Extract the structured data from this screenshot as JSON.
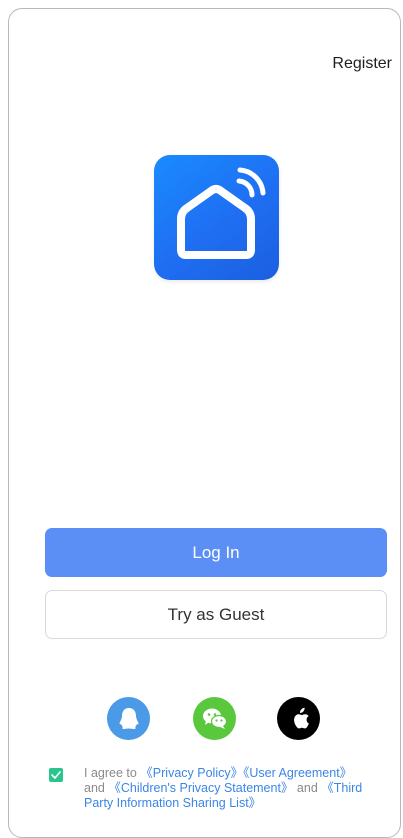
{
  "header": {
    "register_label": "Register"
  },
  "logo": {
    "icon": "smart-home-icon",
    "gradient_from": "#1a8bff",
    "gradient_to": "#1b5fe0"
  },
  "buttons": {
    "login_label": "Log In",
    "guest_label": "Try as Guest",
    "login_color": "#5b8ff6"
  },
  "social": [
    {
      "name": "qq",
      "icon": "qq-penguin-icon",
      "color": "#4a9ae8"
    },
    {
      "name": "wechat",
      "icon": "wechat-icon",
      "color": "#5ac83c"
    },
    {
      "name": "apple",
      "icon": "apple-icon",
      "color": "#000000"
    }
  ],
  "agreement": {
    "checked": true,
    "prefix": "I agree to ",
    "privacy_policy": "《Privacy Policy》",
    "user_agreement": "《User Agreement》",
    "and1": " and ",
    "childrens_privacy": "《Children's Privacy Statement》",
    "and2": " and ",
    "third_party": "《Third Party Information Sharing List》"
  }
}
